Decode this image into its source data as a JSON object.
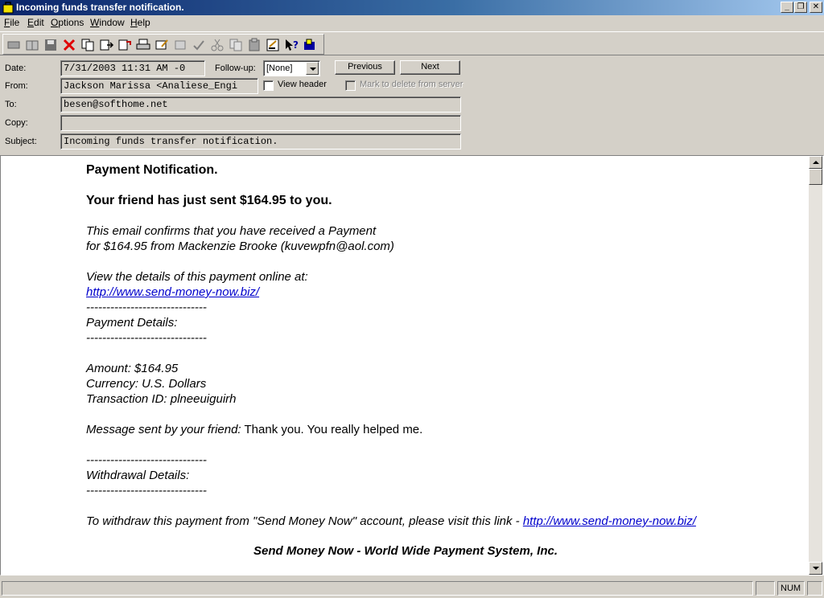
{
  "window": {
    "title": "Incoming funds transfer notification.",
    "controls": {
      "minimize": "_",
      "restore": "❐",
      "close": "✕"
    }
  },
  "menu": [
    {
      "label": "File",
      "ul": "F",
      "rest": "ile"
    },
    {
      "label": "Edit",
      "ul": "E",
      "rest": "dit"
    },
    {
      "label": "Options",
      "ul": "O",
      "rest": "ptions"
    },
    {
      "label": "Window",
      "ul": "W",
      "rest": "indow"
    },
    {
      "label": "Help",
      "ul": "H",
      "rest": "elp"
    }
  ],
  "toolbar": {
    "icons": [
      "move-to-icon",
      "open-folder-icon",
      "save-icon",
      "delete-icon",
      "copy-icon",
      "forward-icon",
      "redirect-icon",
      "print-icon",
      "edit-message-icon",
      "reply-all-icon",
      "spellcheck-icon",
      "cut-icon",
      "copy-clipboard-icon",
      "paste-icon",
      "properties-icon",
      "help-pointer-icon",
      "mailbox-icon"
    ]
  },
  "header": {
    "date_label": "Date:",
    "date_value": "7/31/2003 11:31 AM -0",
    "followup_label": "Follow-up:",
    "followup_value": "[None]",
    "previous_label": "Previous",
    "next_label": "Next",
    "from_label": "From:",
    "from_value": "Jackson Marissa <Analiese_Engi",
    "view_header_label": "View header",
    "mark_delete_label": "Mark to delete from server",
    "to_label": "To:",
    "to_value": "besen@softhome.net",
    "copy_label": "Copy:",
    "copy_value": "",
    "subject_label": "Subject:",
    "subject_value": "Incoming funds transfer notification."
  },
  "message": {
    "heading": "Payment Notification.",
    "sent_line": "Your friend has just sent $164.95 to you.",
    "confirm_1": "This email confirms that you have received a Payment",
    "confirm_2": "for $164.95 from Mackenzie Brooke (kuvewpfn@aol.com)",
    "view_details": "View the details of this payment online at:",
    "link_1": "http://www.send-money-now.biz/",
    "divider": "------------------------------",
    "payment_details": "Payment Details:",
    "amount": "Amount: $164.95",
    "currency": "Currency: U.S. Dollars",
    "transaction": "Transaction ID: plneeuiguirh",
    "msg_label": "Message sent by your friend:",
    "msg_text": " Thank you. You really helped me.",
    "withdrawal_details": "Withdrawal Details:",
    "withdraw_text": "To withdraw this payment from \"Send Money Now\" account, please visit this link - ",
    "link_2": "http://www.send-money-now.biz/",
    "signature": "Send Money Now - World Wide Payment System, Inc."
  },
  "status": {
    "num": "NUM"
  }
}
